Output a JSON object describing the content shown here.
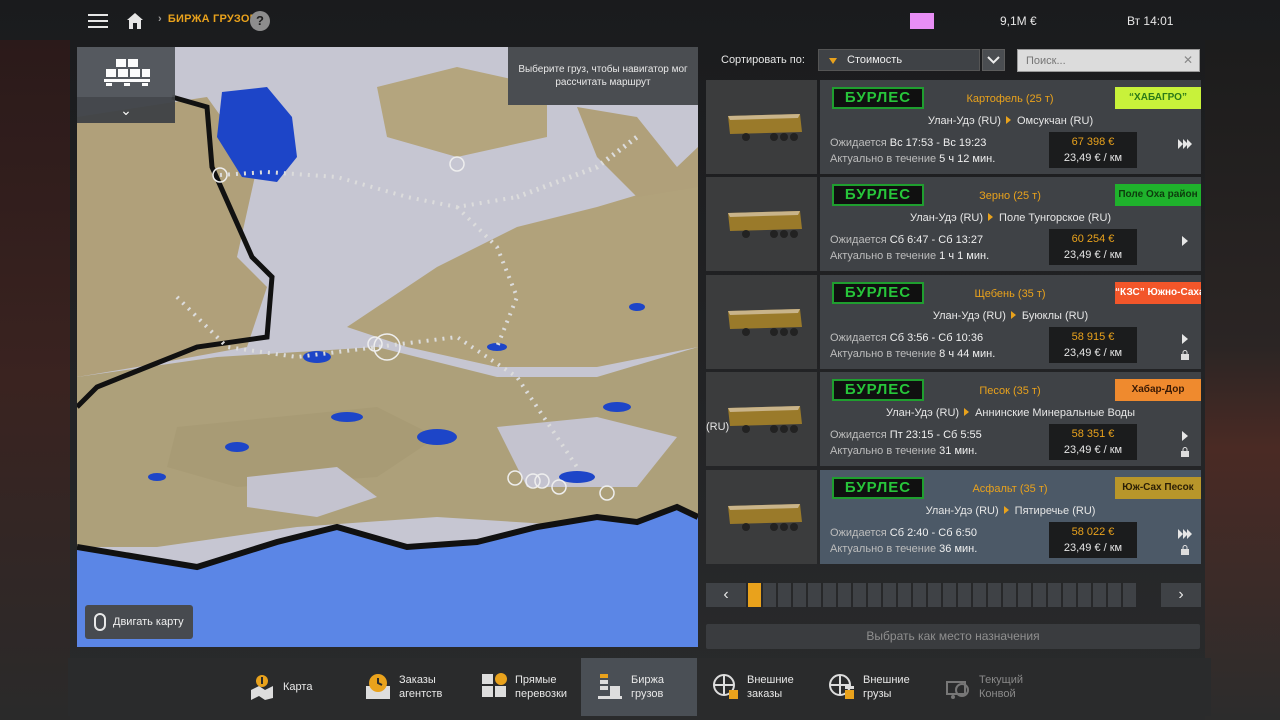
{
  "header": {
    "breadcrumb": "БИРЖА ГРУЗОВ",
    "help": "?",
    "money": "9,1M €",
    "time": "Вт 14:01"
  },
  "map": {
    "tip": "Выберите груз, чтобы навигатор мог рассчитать маршрут",
    "move_button": "Двигать карту",
    "ru_label": "(RU)"
  },
  "sort": {
    "label": "Сортировать по:",
    "value": "Стоимость",
    "search_placeholder": "Поиск..."
  },
  "jobs": [
    {
      "company": "БУРЛЕС",
      "cargo": "Картофель (25 т)",
      "dest_company": "“ХАБАГРО”",
      "dest_colors": {
        "bg": "#c8f23a",
        "fg": "#2a7a18"
      },
      "from": "Улан-Удэ (RU)",
      "to": "Омсукчан (RU)",
      "expected_label": "Ожидается",
      "expected": "Вс 17:53 - Вс 19:23",
      "valid_label": "Актуально в течение",
      "valid": "5 ч 12 мин.",
      "price": "67 398 €",
      "rate": "23,49 € / км",
      "action_icon": "fast-forward-icon",
      "locked": false
    },
    {
      "company": "БУРЛЕС",
      "cargo": "Зерно (25 т)",
      "dest_company": "Поле Оха район",
      "dest_colors": {
        "bg": "#1fb22c",
        "fg": "#0d3c0d"
      },
      "from": "Улан-Удэ (RU)",
      "to": "Поле Тунгорское (RU)",
      "expected_label": "Ожидается",
      "expected": "Сб 6:47 - Сб 13:27",
      "valid_label": "Актуально в течение",
      "valid": "1 ч 1 мин.",
      "price": "60 254 €",
      "rate": "23,49 € / км",
      "action_icon": "play-icon",
      "locked": false
    },
    {
      "company": "БУРЛЕС",
      "cargo": "Щебень (35 т)",
      "dest_company": "“КЗС” Южно-Сахалинск",
      "dest_colors": {
        "bg": "#f2562a",
        "fg": "#ffffff"
      },
      "from": "Улан-Удэ (RU)",
      "to": "Буюклы (RU)",
      "expected_label": "Ожидается",
      "expected": "Сб 3:56 - Сб 10:36",
      "valid_label": "Актуально в течение",
      "valid": "8 ч 44 мин.",
      "price": "58 915 €",
      "rate": "23,49 € / км",
      "action_icon": "play-icon",
      "locked": true
    },
    {
      "company": "БУРЛЕС",
      "cargo": "Песок (35 т)",
      "dest_company": "Хабар-Дор",
      "dest_colors": {
        "bg": "#ef8a2e",
        "fg": "#3a1a05"
      },
      "from": "Улан-Удэ (RU)",
      "to": "Аннинские Минеральные Воды",
      "expected_label": "Ожидается",
      "expected": "Пт 23:15 - Сб 5:55",
      "valid_label": "Актуально в течение",
      "valid": "31 мин.",
      "price": "58 351 €",
      "rate": "23,49 € / км",
      "action_icon": "play-icon",
      "locked": true
    },
    {
      "company": "БУРЛЕС",
      "cargo": "Асфальт (35 т)",
      "dest_company": "Юж-Сах Песок",
      "dest_colors": {
        "bg": "#b8962a",
        "fg": "#2b1f06"
      },
      "from": "Улан-Удэ (RU)",
      "to": "Пятиречье (RU)",
      "expected_label": "Ожидается",
      "expected": "Сб 2:40 - Сб 6:50",
      "valid_label": "Актуально в течение",
      "valid": "36 мин.",
      "price": "58 022 €",
      "rate": "23,49 € / км",
      "action_icon": "fast-forward-icon",
      "locked": true
    }
  ],
  "pager": {
    "prev": "‹",
    "next": "›",
    "pages": 26,
    "current": 1
  },
  "set_destination": "Выбрать как место назначения",
  "nav": [
    {
      "label": "Карта",
      "icon": "map-icon",
      "active": false,
      "dim": false
    },
    {
      "label": "Заказы агентств",
      "icon": "clock-icon",
      "active": false,
      "dim": false
    },
    {
      "label": "Прямые перевозки",
      "icon": "crates-icon",
      "active": false,
      "dim": false
    },
    {
      "label": "Биржа грузов",
      "icon": "freight-market-icon",
      "active": true,
      "dim": false
    },
    {
      "label": "Внешние заказы",
      "icon": "globe-icon",
      "active": false,
      "dim": false
    },
    {
      "label": "Внешние грузы",
      "icon": "globe-cargo-icon",
      "active": false,
      "dim": false
    },
    {
      "label": "Текущий Конвой",
      "icon": "convoy-icon",
      "active": false,
      "dim": true
    }
  ],
  "colors": {
    "accent": "#e9a21c",
    "panel": "#3f4246",
    "selected": "#4c5967",
    "company_green": "#27c53a"
  }
}
